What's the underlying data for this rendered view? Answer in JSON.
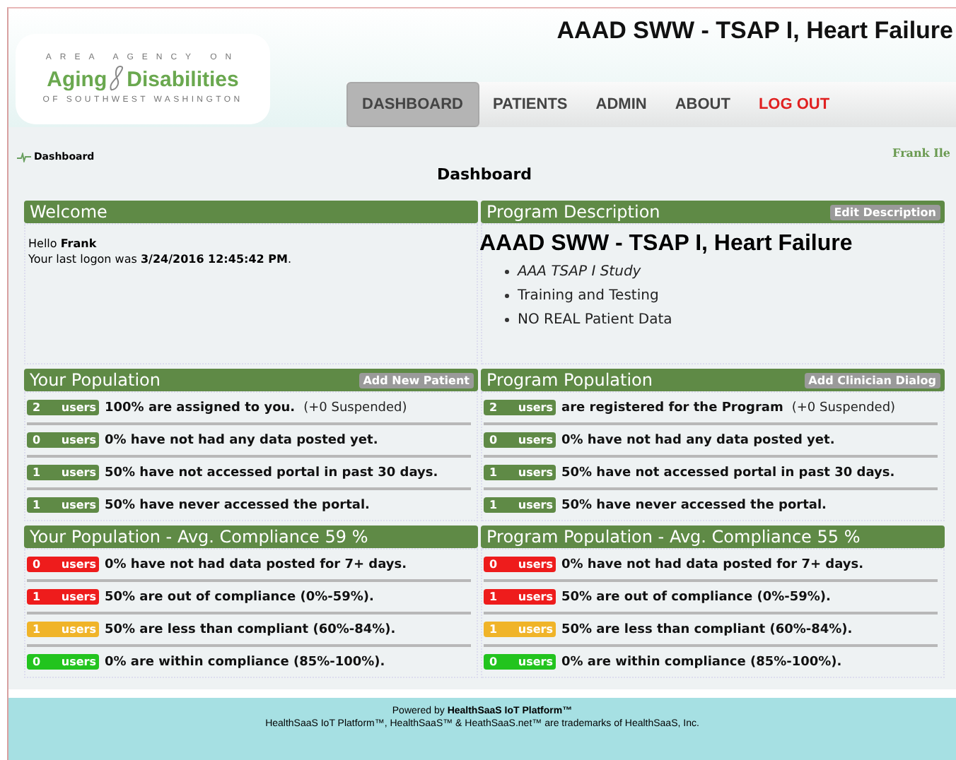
{
  "header": {
    "title": "AAAD SWW - TSAP I, Heart Failure",
    "logo": {
      "top": "AREA AGENCY ON",
      "left": "Aging",
      "right": "Disabilities",
      "bottom": "OF SOUTHWEST WASHINGTON"
    }
  },
  "nav": [
    {
      "label": "DASHBOARD",
      "selected": true,
      "kind": "link"
    },
    {
      "label": "PATIENTS",
      "selected": false,
      "kind": "link"
    },
    {
      "label": "ADMIN",
      "selected": false,
      "kind": "link"
    },
    {
      "label": "ABOUT",
      "selected": false,
      "kind": "link"
    },
    {
      "label": "LOG OUT",
      "selected": false,
      "kind": "logout"
    }
  ],
  "breadcrumb": "Dashboard",
  "user": "Frank Ile",
  "page_title": "Dashboard",
  "sections": [
    {
      "kind": "welcome",
      "title": "Welcome",
      "lines": [
        "Hello **Frank**",
        "Your last logon was **3/24/2016 12:45:42 PM**."
      ]
    },
    {
      "kind": "description",
      "title": "Program Description",
      "action": "Edit Description",
      "heading": "AAAD SWW - TSAP I, Heart Failure",
      "items": [
        {
          "text": "AAA TSAP I Study",
          "italic": true
        },
        {
          "text": "Training and Testing",
          "italic": false
        },
        {
          "text": "NO REAL Patient Data",
          "italic": false
        }
      ]
    },
    {
      "kind": "stats",
      "title": "Your Population",
      "action": "Add New Patient",
      "rows": [
        {
          "count": "2",
          "unit": "users",
          "color": "#5f8a46",
          "text": "100% are assigned to you.",
          "note": "(+0 Suspended)"
        },
        {
          "count": "0",
          "unit": "users",
          "color": "#5f8a46",
          "text": "0% have not had any data posted yet."
        },
        {
          "count": "1",
          "unit": "users",
          "color": "#5f8a46",
          "text": "50% have not accessed portal in past 30 days."
        },
        {
          "count": "1",
          "unit": "users",
          "color": "#5f8a46",
          "text": "50% have never accessed the portal."
        }
      ]
    },
    {
      "kind": "stats",
      "title": "Program Population",
      "action": "Add Clinician Dialog",
      "rows": [
        {
          "count": "2",
          "unit": "users",
          "color": "#5f8a46",
          "text": "are registered for the Program",
          "note": "(+0 Suspended)"
        },
        {
          "count": "0",
          "unit": "users",
          "color": "#5f8a46",
          "text": "0% have not had any data posted yet."
        },
        {
          "count": "1",
          "unit": "users",
          "color": "#5f8a46",
          "text": "50% have not accessed portal in past 30 days."
        },
        {
          "count": "1",
          "unit": "users",
          "color": "#5f8a46",
          "text": "50% have never accessed the portal."
        }
      ]
    },
    {
      "kind": "stats",
      "title": "Your Population - Avg. Compliance 59 %",
      "rows": [
        {
          "count": "0",
          "unit": "users",
          "color": "#ee1c1c",
          "text": "0% have not had data posted for 7+ days."
        },
        {
          "count": "1",
          "unit": "users",
          "color": "#ee1c1c",
          "text": "50% are out of compliance (0%-59%)."
        },
        {
          "count": "1",
          "unit": "users",
          "color": "#f0b429",
          "text": "50% are less than compliant (60%-84%)."
        },
        {
          "count": "0",
          "unit": "users",
          "color": "#22c41e",
          "text": "0% are within compliance (85%-100%)."
        }
      ]
    },
    {
      "kind": "stats",
      "title": "Program Population - Avg. Compliance 55 %",
      "rows": [
        {
          "count": "0",
          "unit": "users",
          "color": "#ee1c1c",
          "text": "0% have not had data posted for 7+ days."
        },
        {
          "count": "1",
          "unit": "users",
          "color": "#ee1c1c",
          "text": "50% are out of compliance (0%-59%)."
        },
        {
          "count": "1",
          "unit": "users",
          "color": "#f0b429",
          "text": "50% are less than compliant (60%-84%)."
        },
        {
          "count": "0",
          "unit": "users",
          "color": "#22c41e",
          "text": "0% are within compliance (85%-100%)."
        }
      ]
    }
  ],
  "footer": [
    "Powered by **HealthSaaS IoT Platform™**",
    "HealthSaaS IoT Platform™, HealthSaaS™ & HeathSaaS.net™ are trademarks of HealthSaaS, Inc."
  ]
}
